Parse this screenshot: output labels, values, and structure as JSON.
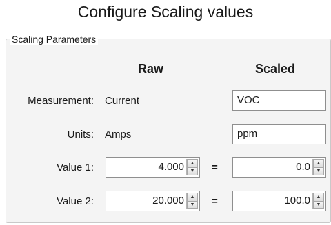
{
  "title": "Configure Scaling values",
  "group": {
    "title": "Scaling Parameters",
    "columns": {
      "raw": "Raw",
      "scaled": "Scaled"
    }
  },
  "rows": {
    "measurement": {
      "label": "Measurement:",
      "raw": "Current",
      "scaled": "VOC"
    },
    "units": {
      "label": "Units:",
      "raw": "Amps",
      "scaled": "ppm"
    },
    "value1": {
      "label": "Value 1:",
      "raw": "4.000",
      "equals": "=",
      "scaled": "0.0"
    },
    "value2": {
      "label": "Value 2:",
      "raw": "20.000",
      "equals": "=",
      "scaled": "100.0"
    }
  },
  "icons": {
    "spin_up": "spin-up-icon",
    "spin_down": "spin-down-icon"
  }
}
